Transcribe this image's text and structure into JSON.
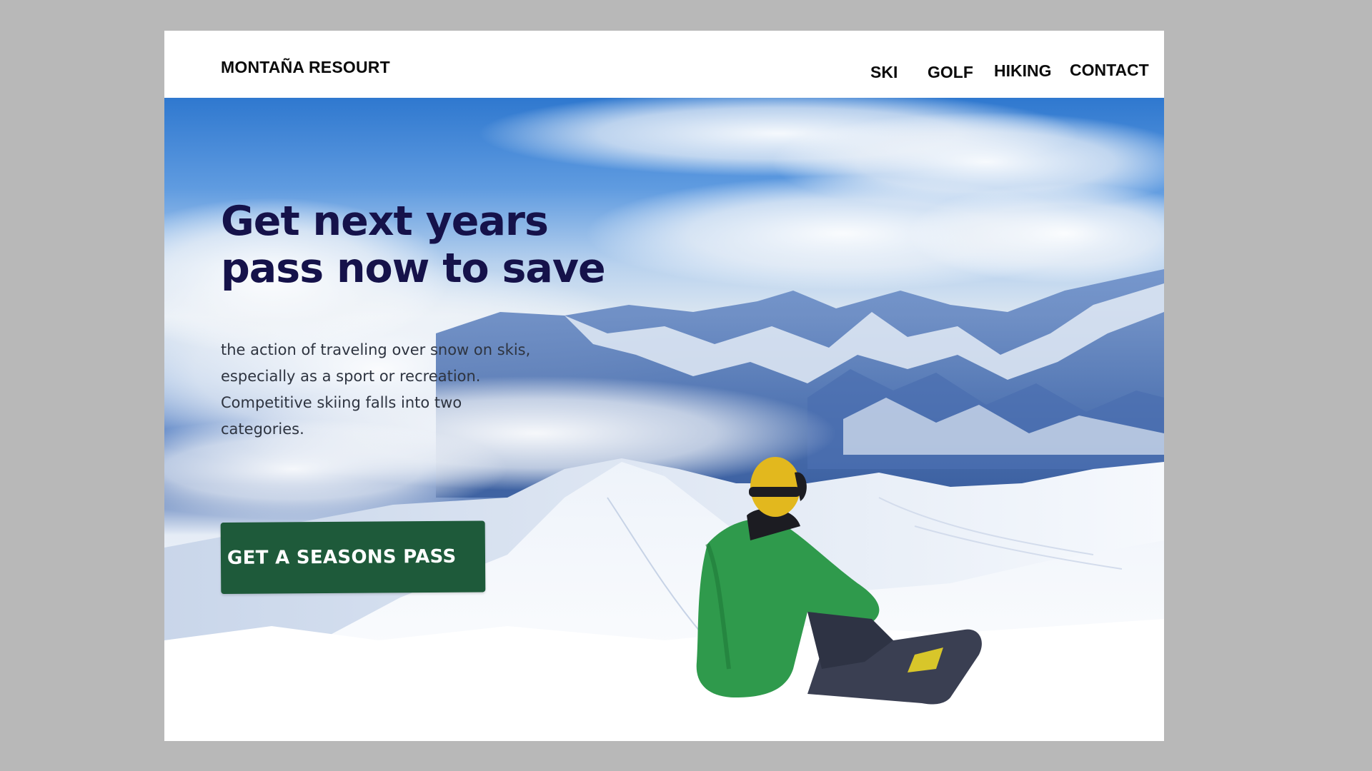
{
  "brand": "MONTAÑA RESOURT",
  "nav": {
    "items": [
      {
        "label": "SKI"
      },
      {
        "label": "GOLF"
      },
      {
        "label": "HIKING"
      },
      {
        "label": "CONTACT"
      }
    ]
  },
  "hero": {
    "headline_lines": [
      "Get next years",
      "pass now to save"
    ],
    "body_lines": [
      "the action of traveling over snow on skis,",
      "especially as a sport or recreation.",
      "Competitive skiing falls into two",
      "categories."
    ],
    "cta_label": "GET A SEASONS PASS"
  },
  "colors": {
    "page_background": "#b8b8b8",
    "headline": "#15124a",
    "cta_background": "#1e5a3a",
    "cta_text": "#ffffff"
  }
}
